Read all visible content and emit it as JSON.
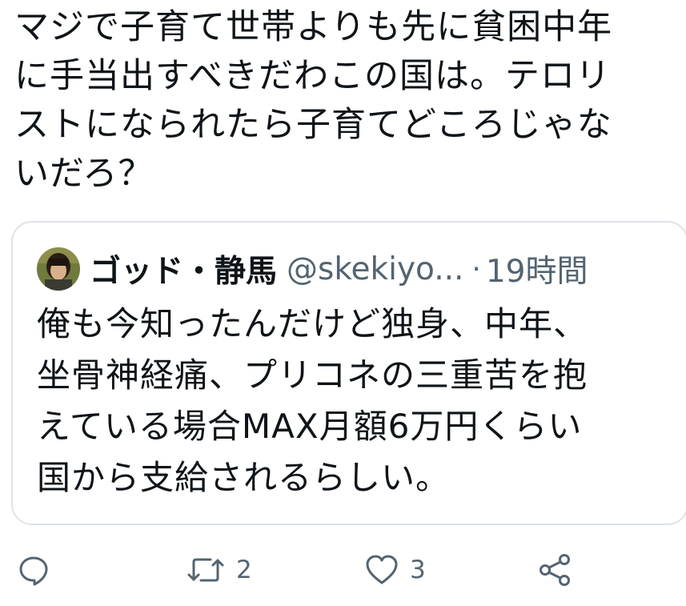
{
  "tweet": {
    "text": "マジで子育て世帯よりも先に貧困中年\nに手当出すべきだわこの国は。テロリ\nストになられたら子育てどころじゃな\nいだろ？"
  },
  "quoted_tweet": {
    "author_name": "ゴッド・静馬",
    "author_handle": "@skekiyo...",
    "separator": "·",
    "time_ago": "19時間",
    "text": "俺も今知ったんだけど独身、中年、\n坐骨神経痛、プリコネの三重苦を抱\nえている場合MAX月額6万円くらい\n国から支給されるらしい。"
  },
  "actions": {
    "reply": {
      "icon": "reply-icon",
      "count": ""
    },
    "retweet": {
      "icon": "retweet-icon",
      "count": "2"
    },
    "like": {
      "icon": "heart-icon",
      "count": "3"
    },
    "share": {
      "icon": "share-icon",
      "count": ""
    }
  },
  "colors": {
    "text": "#0f1419",
    "secondary": "#536471",
    "card_border": "#dde3e8"
  }
}
